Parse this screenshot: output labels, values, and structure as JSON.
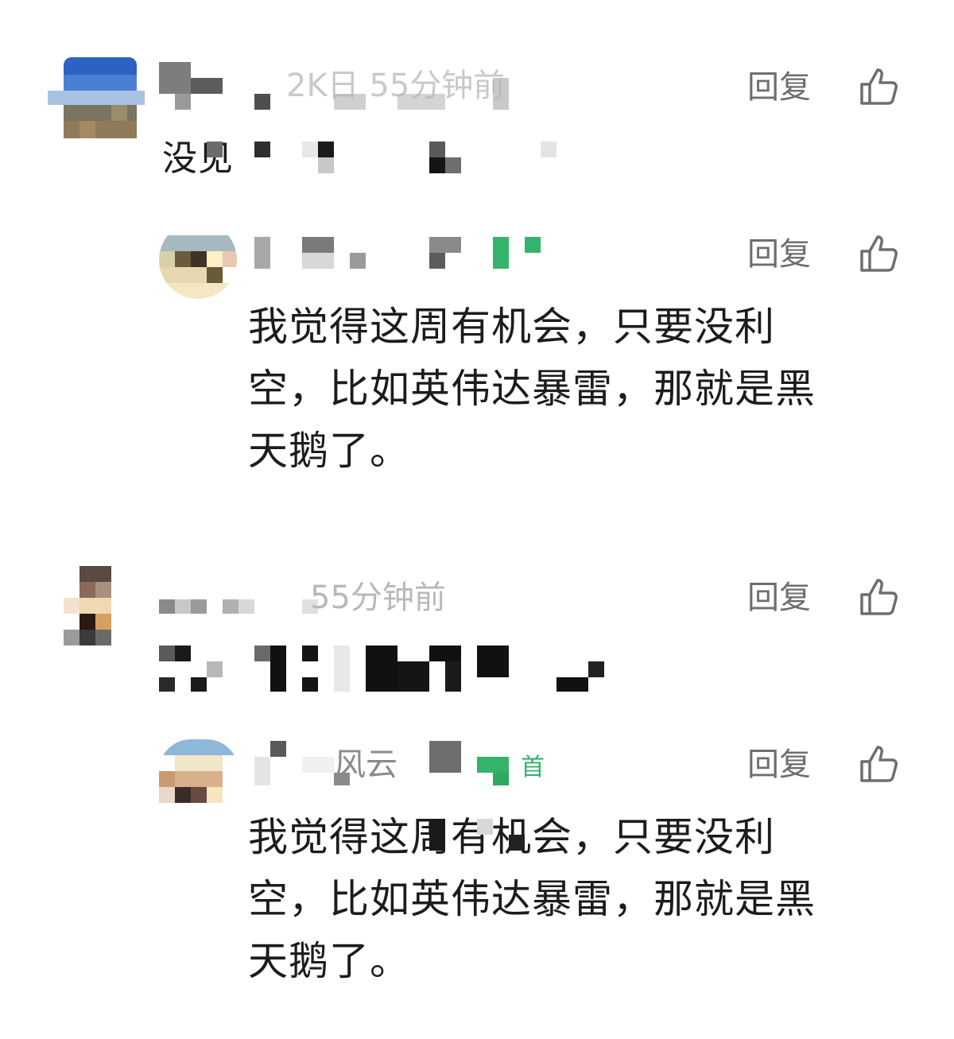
{
  "comments": [
    {
      "id": "c1",
      "meta": "2K日 55分钟前",
      "content_partial": "没见",
      "reply_label": "回复",
      "like_icon": "thumbs-up-icon",
      "reply": {
        "author_partial": "",
        "content": "我觉得这周有机会，只要没利\n空，比如英伟达暴雷，那就是黑\n天鹅了。",
        "reply_label": "回复",
        "like_icon": "thumbs-up-icon"
      }
    },
    {
      "id": "c2",
      "meta": "55分钟前",
      "content_partial": "",
      "reply_label": "回复",
      "like_icon": "thumbs-up-icon",
      "reply": {
        "author_partial": "风云",
        "badge": "首",
        "content": "我觉得这周有机会，只要没利\n空，比如英伟达暴雷，那就是黑\n天鹅了。",
        "reply_label": "回复",
        "like_icon": "thumbs-up-icon"
      }
    }
  ],
  "colors": {
    "text_primary": "#1c1c1c",
    "text_meta": "#b8b8b8",
    "action_gray": "#6e6e6e",
    "badge_green": "#34b36a"
  }
}
